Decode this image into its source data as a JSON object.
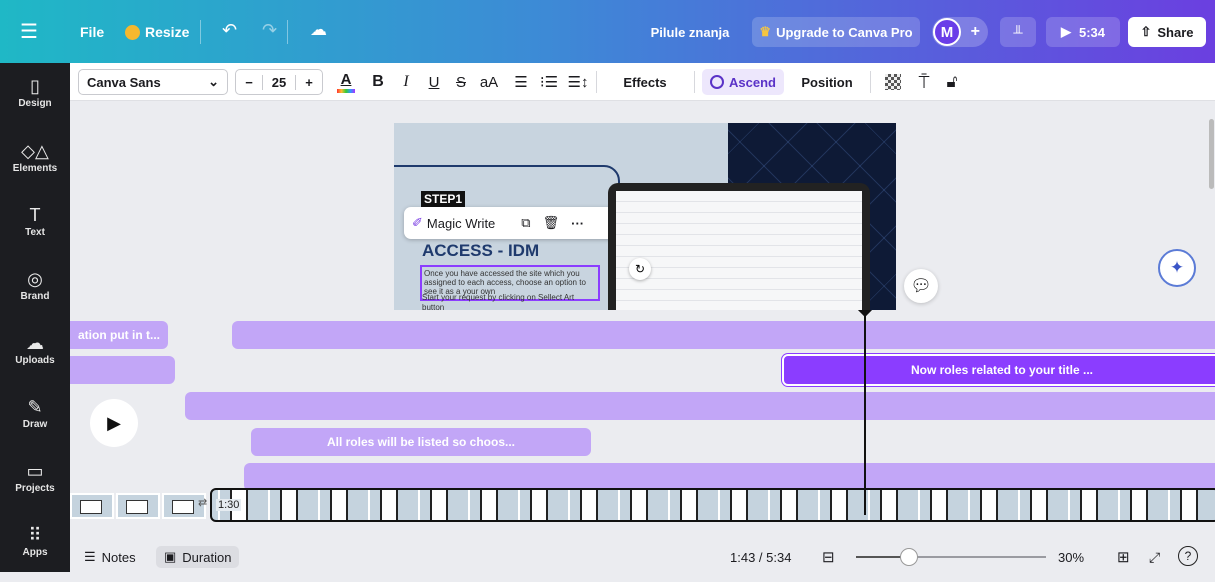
{
  "topbar": {
    "file": "File",
    "resize": "Resize",
    "doc_title": "Pilule znanja",
    "upgrade": "Upgrade to Canva Pro",
    "avatar": "M",
    "play_time": "5:34",
    "share": "Share"
  },
  "sidebar": {
    "items": [
      {
        "label": "Design",
        "icon": "▯"
      },
      {
        "label": "Elements",
        "icon": "◇△"
      },
      {
        "label": "Text",
        "icon": "T"
      },
      {
        "label": "Brand",
        "icon": "◎"
      },
      {
        "label": "Uploads",
        "icon": "☁"
      },
      {
        "label": "Draw",
        "icon": "✎"
      },
      {
        "label": "Projects",
        "icon": "▭"
      },
      {
        "label": "Apps",
        "icon": "⠿"
      }
    ]
  },
  "toolbar": {
    "font": "Canva Sans",
    "font_size": "25",
    "minus": "−",
    "plus": "+",
    "color_letter": "A",
    "bold": "B",
    "italic": "I",
    "underline": "U",
    "strike": "S",
    "case": "aA",
    "effects": "Effects",
    "ascend": "Ascend",
    "position": "Position"
  },
  "slide": {
    "step": "STEP1",
    "magic_write": "Magic Write",
    "heading": "ACCESS - IDM",
    "body_text": "Once you have accessed the site which you assigned to each access, choose an option to see it as a your own",
    "body_text_2": "Start your request by clicking on Sellect Art",
    "body_text_3": "button"
  },
  "timeline": {
    "tracks": [
      "ation put in t...",
      "",
      "Now roles related to your title ...",
      "",
      "All roles will be listed so choos...",
      ""
    ],
    "marker_time": "1:30"
  },
  "bottombar": {
    "notes": "Notes",
    "duration": "Duration",
    "time": "1:43 / 5:34",
    "zoom": "30%"
  },
  "colors": {
    "accent": "#8b3dff",
    "track": "#c2a6f7",
    "sidebar_bg": "#1c1d21"
  }
}
